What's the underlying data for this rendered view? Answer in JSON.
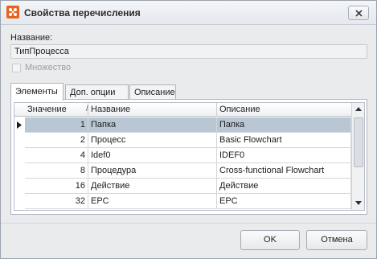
{
  "window": {
    "title": "Свойства перечисления",
    "icon": "settings-dots-icon"
  },
  "form": {
    "name_label": "Название:",
    "name_value": "ТипПроцесса",
    "multiset_label": "Множество",
    "multiset_checked": false
  },
  "tabs": [
    {
      "label": "Элементы",
      "active": true
    },
    {
      "label": "Доп. опции",
      "active": false
    },
    {
      "label": "Описание",
      "active": false
    }
  ],
  "grid": {
    "columns": {
      "value": "Значение",
      "name": "Название",
      "description": "Описание"
    },
    "sort_indicator": "/",
    "rows": [
      {
        "value": "1",
        "name": "Папка",
        "description": "Папка",
        "selected": true
      },
      {
        "value": "2",
        "name": "Процесс",
        "description": "Basic Flowchart",
        "selected": false
      },
      {
        "value": "4",
        "name": "Idef0",
        "description": "IDEF0",
        "selected": false
      },
      {
        "value": "8",
        "name": "Процедура",
        "description": "Cross-functional Flowchart",
        "selected": false
      },
      {
        "value": "16",
        "name": "Действие",
        "description": "Действие",
        "selected": false
      },
      {
        "value": "32",
        "name": "EPC",
        "description": "EPC",
        "selected": false
      }
    ]
  },
  "buttons": {
    "ok": "OK",
    "cancel": "Отмена"
  },
  "colors": {
    "selected_row": "#b9c6d3",
    "app_icon": "#e8641c"
  }
}
